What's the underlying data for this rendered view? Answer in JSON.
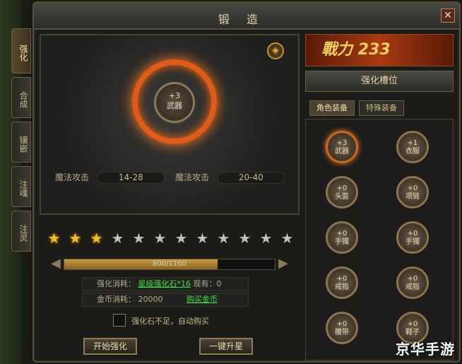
{
  "window": {
    "title": "锻造",
    "close_label": "✕"
  },
  "sidetabs": [
    "强化",
    "合成",
    "镶嵌",
    "注魂",
    "注灵"
  ],
  "forge": {
    "center_item": {
      "level": "+3",
      "name": "武器"
    },
    "corner_icon": "forge-rune-icon",
    "stat_left": {
      "label": "魔法攻击",
      "value": "14-28"
    },
    "stat_right": {
      "label": "魔法攻击",
      "value": "20-40"
    }
  },
  "stars": {
    "total": 12,
    "lit": 3
  },
  "progress": {
    "text": "800/1100",
    "fraction": 0.727
  },
  "costs": {
    "stone_label": "强化消耗：",
    "stone_value": "星级强化石*16",
    "stone_have": "现有：0",
    "gold_label": "金币消耗：",
    "gold_value": "20000",
    "gold_link": "购买金币"
  },
  "auto_buy": {
    "checked": false,
    "label": "强化石不足，自动购买"
  },
  "buttons": {
    "start": "开始强化",
    "one_click": "一键升星"
  },
  "power": {
    "label": "戰力",
    "value": "233"
  },
  "slot_panel": {
    "title": "强化槽位",
    "tabs": [
      "角色装备",
      "特殊装备"
    ],
    "slots": [
      {
        "level": "+3",
        "name": "武器"
      },
      {
        "level": "+1",
        "name": "衣服"
      },
      {
        "level": "+0",
        "name": "头盔"
      },
      {
        "level": "+0",
        "name": "项链"
      },
      {
        "level": "+0",
        "name": "手镯"
      },
      {
        "level": "+0",
        "name": "手镯"
      },
      {
        "level": "+0",
        "name": "戒指"
      },
      {
        "level": "+0",
        "name": "戒指"
      },
      {
        "level": "+0",
        "name": "腰带"
      },
      {
        "level": "+0",
        "name": "鞋子"
      }
    ]
  },
  "watermark": "京华手游",
  "colors": {
    "accent": "#e05a18",
    "link": "#40e040",
    "gold": "#f0c020"
  }
}
